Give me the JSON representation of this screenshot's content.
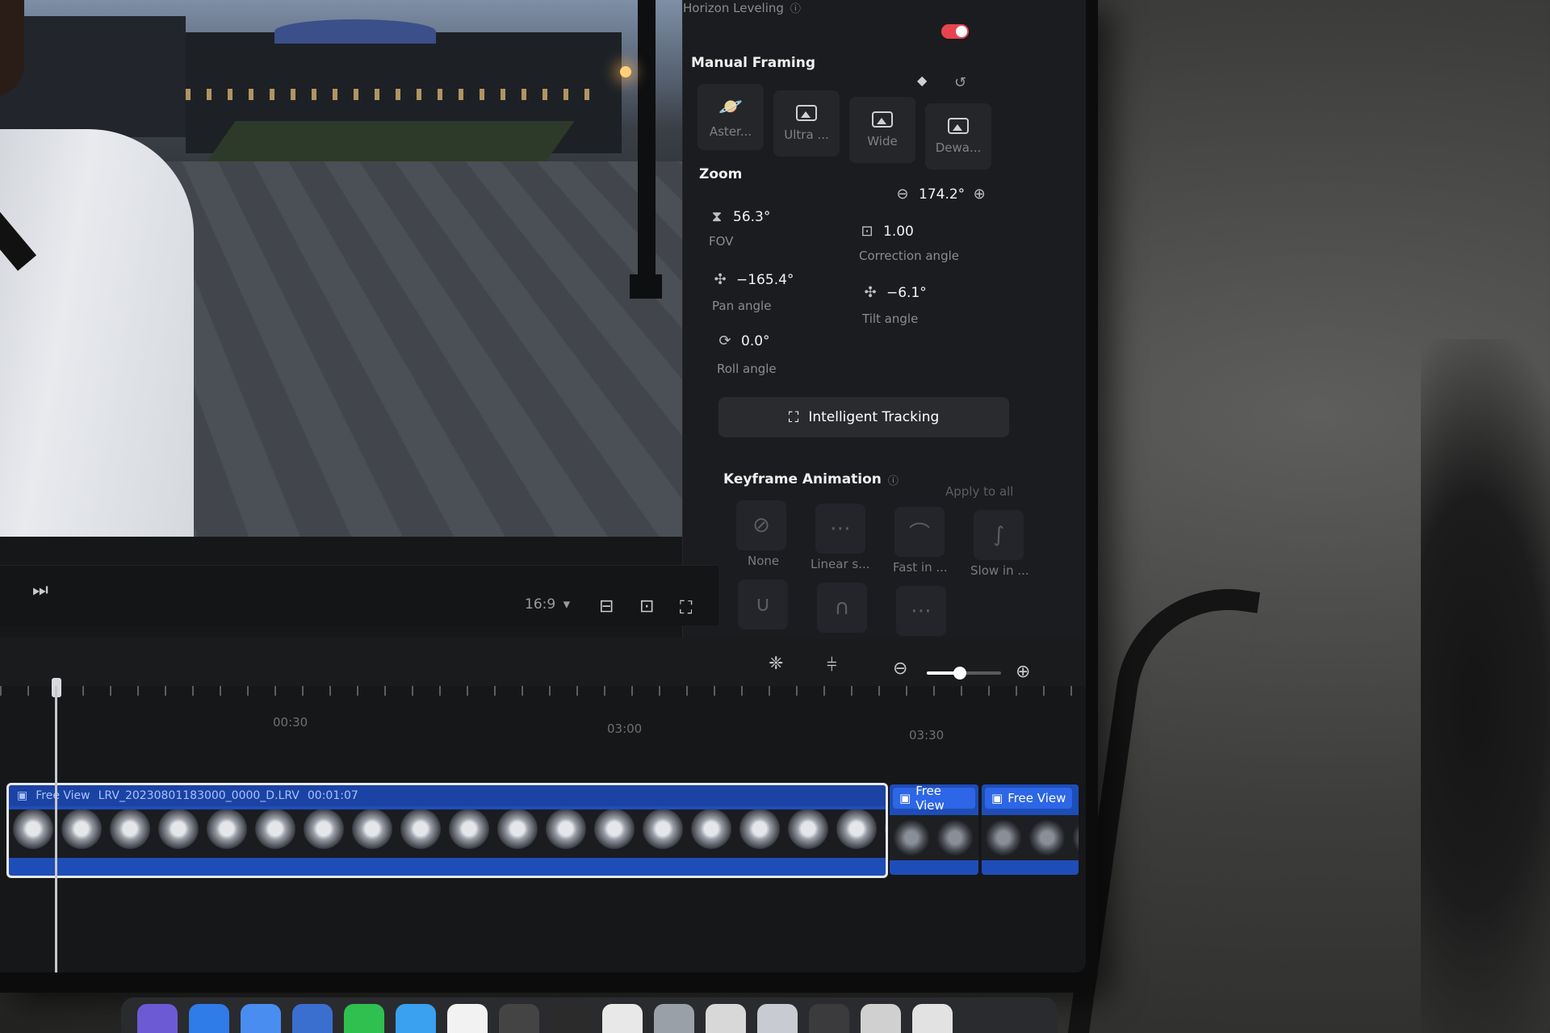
{
  "panel": {
    "horizon_label": "Horizon Leveling",
    "manual_framing_label": "Manual Framing",
    "modes": [
      {
        "label": "Aster..."
      },
      {
        "label": "Ultra ..."
      },
      {
        "label": "Wide"
      },
      {
        "label": "Dewa..."
      }
    ],
    "zoom_label": "Zoom",
    "zoom_value": "174.2°",
    "fov_value": "56.3°",
    "fov_label": "FOV",
    "correction_value": "1.00",
    "correction_label": "Correction angle",
    "pan_value": "−165.4°",
    "pan_label": "Pan angle",
    "tilt_value": "−6.1°",
    "tilt_label": "Tilt angle",
    "roll_value": "0.0°",
    "roll_label": "Roll angle",
    "tracking_label": "Intelligent Tracking",
    "keyframe_label": "Keyframe Animation",
    "apply_all_label": "Apply to all",
    "curves": [
      {
        "label": "None"
      },
      {
        "label": "Linear s..."
      },
      {
        "label": "Fast in ..."
      },
      {
        "label": "Slow in ..."
      }
    ],
    "accent_color": "#e9434f"
  },
  "player": {
    "aspect_ratio": "16:9"
  },
  "timeline": {
    "timecodes": [
      "00:30",
      "03:00",
      "03:30"
    ],
    "zoom_level": 0.45,
    "main_clip": {
      "title": "Free View",
      "filename": "LRV_20230801183000_0000_D.LRV",
      "duration": "00:01:07"
    },
    "side_clips": [
      {
        "label": "Free View"
      },
      {
        "label": "Free View"
      }
    ],
    "clip_color": "#1f4db8",
    "badge_color": "#2d66e6"
  }
}
